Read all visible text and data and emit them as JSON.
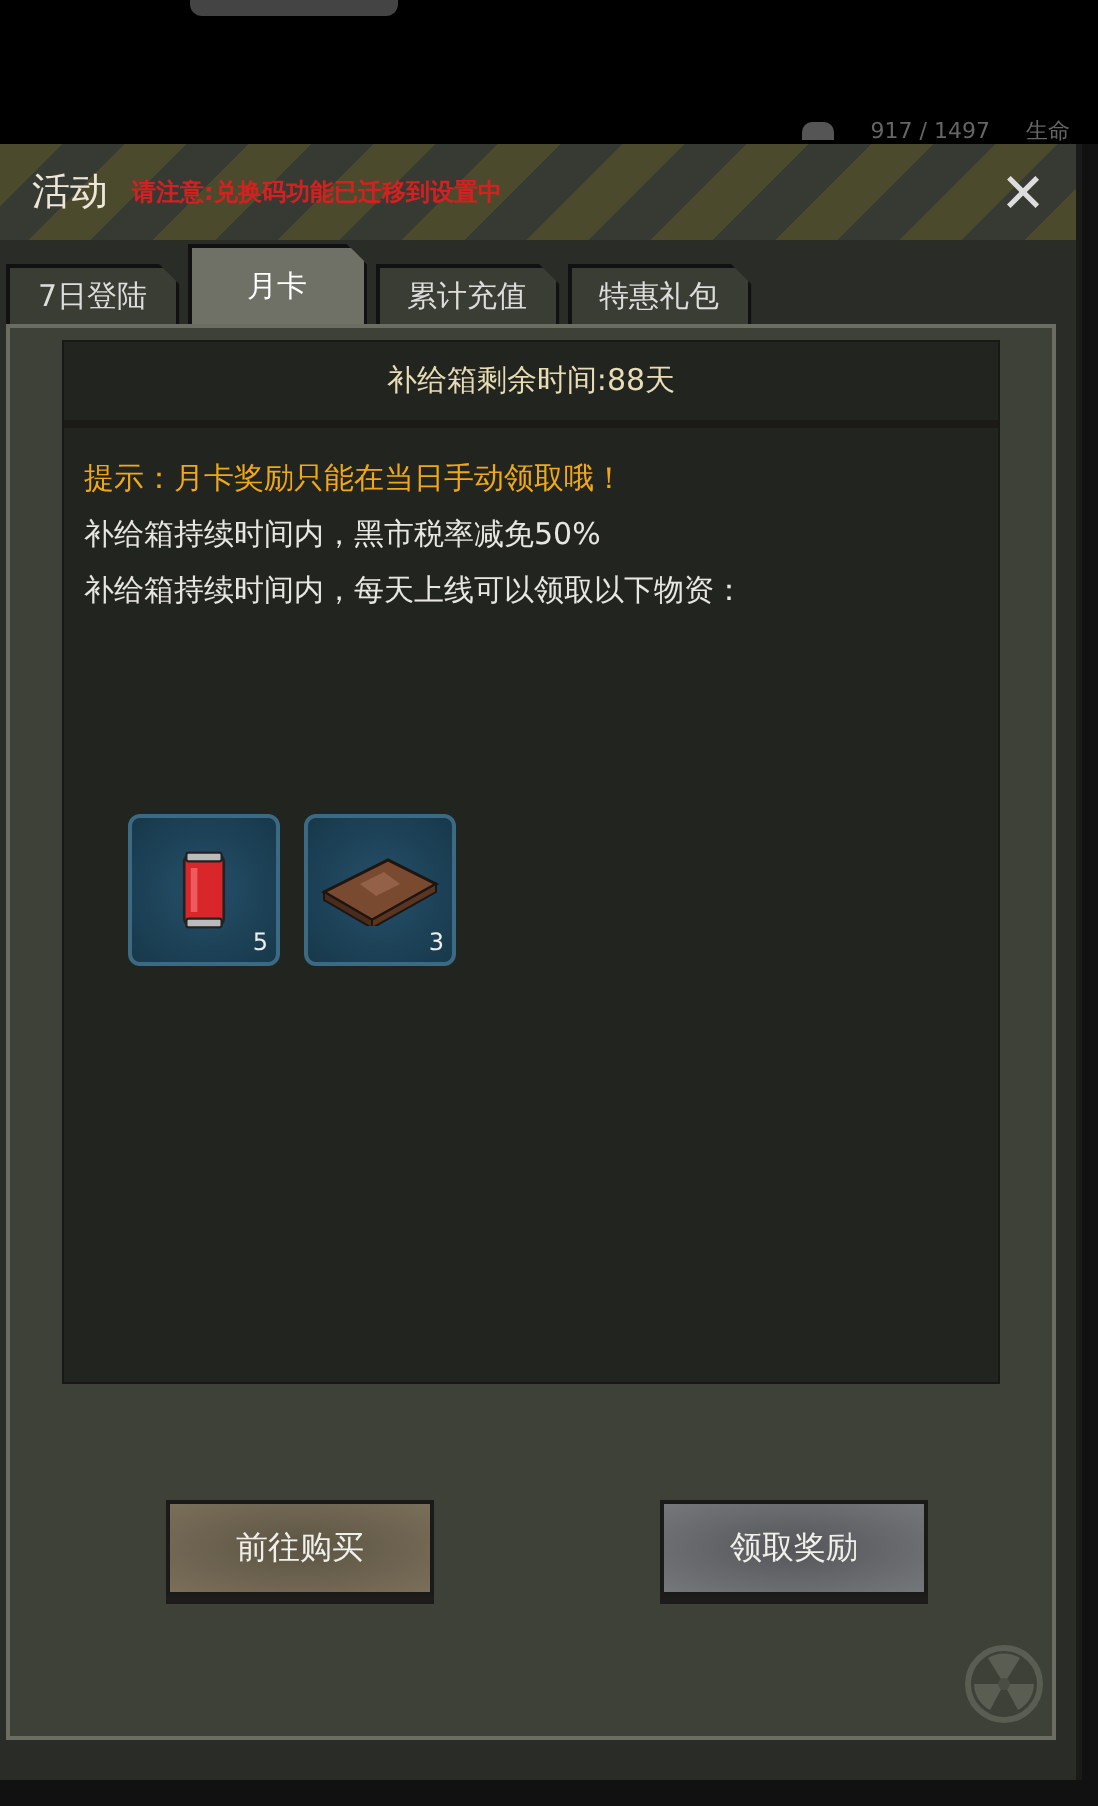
{
  "status": {
    "reading": "917 / 1497",
    "label": "生命"
  },
  "dialog": {
    "title": "活动",
    "notice": "请注意:兑换码功能已迁移到设置中",
    "close": "×"
  },
  "tabs": [
    {
      "label": "7日登陆",
      "selected": false
    },
    {
      "label": "月卡",
      "selected": true
    },
    {
      "label": "累计充值",
      "selected": false
    },
    {
      "label": "特惠礼包",
      "selected": false
    }
  ],
  "panel": {
    "header": "补给箱剩余时间:88天",
    "tip": "提示：月卡奖励只能在当日手动领取哦！",
    "lines": [
      "补给箱持续时间内，黑市税率减免50%",
      "补给箱持续时间内，每天上线可以领取以下物资："
    ]
  },
  "items": [
    {
      "kind": "can",
      "count": "5"
    },
    {
      "kind": "book",
      "count": "3"
    }
  ],
  "buttons": [
    {
      "label": "前往购买",
      "kind": "gold"
    },
    {
      "label": "领取奖励",
      "kind": "grey"
    }
  ]
}
